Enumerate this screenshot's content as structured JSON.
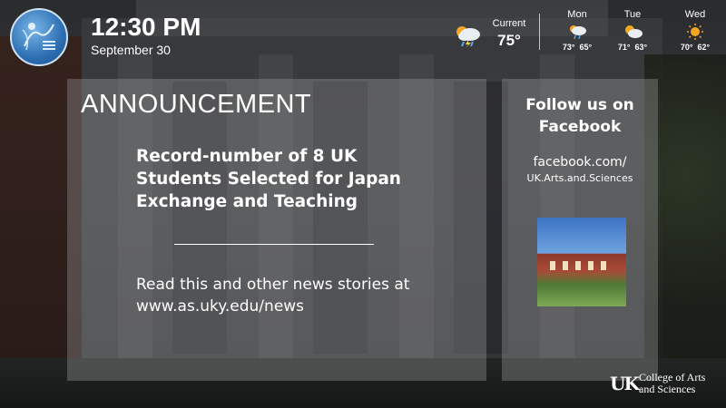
{
  "header": {
    "time": "12:30 PM",
    "date": "September 30"
  },
  "weather": {
    "current": {
      "label": "Current",
      "temp": "75°",
      "icon": "cloud-rain-lightning-icon"
    },
    "forecast": [
      {
        "day": "Mon",
        "high": "73°",
        "low": "65°",
        "icon": "cloud-rain-sun-icon"
      },
      {
        "day": "Tue",
        "high": "71°",
        "low": "63°",
        "icon": "partly-cloudy-icon"
      },
      {
        "day": "Wed",
        "high": "70°",
        "low": "62°",
        "icon": "sun-icon"
      }
    ]
  },
  "announcement": {
    "title": "ANNOUNCEMENT",
    "headline": "Record-number of 8 UK Students Selected for Japan Exchange and Teaching",
    "body": "Read this and other news stories at www.as.uky.edu/news"
  },
  "facebook": {
    "title": "Follow us on Facebook",
    "url_line1": "facebook.com/",
    "url_line2": "UK.Arts.and.Sciences"
  },
  "footer": {
    "logo_mark": "UK",
    "logo_line1": "College of Arts",
    "logo_line2": "and Sciences"
  },
  "colors": {
    "sun": "#f4a623",
    "cloud": "#e9eef3",
    "rain": "#5aa9e6"
  }
}
